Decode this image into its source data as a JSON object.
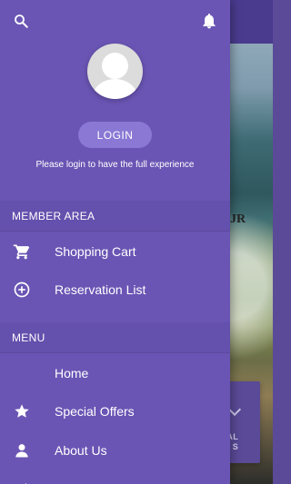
{
  "drawer": {
    "login_button": "LOGIN",
    "login_note": "Please login to have the full experience",
    "sections": {
      "member_area": {
        "title": "MEMBER AREA",
        "items": [
          {
            "label": "Shopping Cart",
            "icon": "shopping-cart-icon"
          },
          {
            "label": "Reservation List",
            "icon": "add-circle-icon"
          }
        ]
      },
      "menu": {
        "title": "MENU",
        "items": [
          {
            "label": "Home",
            "icon": ""
          },
          {
            "label": "Special Offers",
            "icon": "star-icon"
          },
          {
            "label": "About Us",
            "icon": "person-icon"
          }
        ]
      }
    },
    "icons": {
      "top_left": "search-icon",
      "top_right": "bell-icon"
    }
  },
  "background": {
    "partial_heading_fragment": "JR",
    "partial_card_text": "AL\nS"
  },
  "colors": {
    "drawer": "#6a55b4",
    "section_header": "#6450ad",
    "login_button": "#8a78d4",
    "text": "#ffffff"
  }
}
